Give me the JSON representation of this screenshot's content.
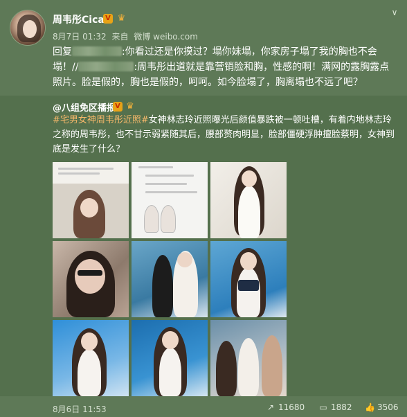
{
  "post": {
    "username": "周韦彤Cica",
    "verified_badge": "V",
    "date": "8月7日 01:32",
    "via_label": "来自",
    "source": "微博 weibo.com",
    "reply_prefix": "回复",
    "text_part1": ":你看过还是你摸过？塌你妹塌，你家房子塌了我的胸也不会塌！//",
    "text_part2": ":周韦彤出道就是靠营销脸和胸，性感的啊！满网的露胸露点照片。脸是假的，胸也是假的，呵呵。如今脸塌了，胸离塌也不远了吧？"
  },
  "repost": {
    "author": "@八组免区播报",
    "verified_badge": "V",
    "hashtag": "#宅男女神周韦彤近照#",
    "text": "女神林志玲近照曝光后颜值暴跌被一顿吐槽，有着内地林志玲之称的周韦彤，也不甘示弱紧随其后，腰部赘肉明显，脸部僵硬浮肿擅脸蔡明，女神到底是发生了什么？",
    "images": [
      {
        "name": "weibo-screenshot-photo"
      },
      {
        "name": "chat-screenshot-photo"
      },
      {
        "name": "white-dress-photo"
      },
      {
        "name": "glasses-selfie-photo"
      },
      {
        "name": "event-stage-photo-1"
      },
      {
        "name": "event-stage-photo-2"
      },
      {
        "name": "event-stage-photo-3"
      },
      {
        "name": "event-stage-photo-4"
      },
      {
        "name": "event-group-photo"
      }
    ],
    "date": "8月6日 11:53",
    "forwards": "11680",
    "comments": "1882",
    "likes": "3506"
  },
  "colors": {
    "background": "#5e7957",
    "repost_background": "#54704d",
    "hashtag": "#f6b86a",
    "badge": "#e8a317"
  },
  "icons": {
    "forward": "forward-icon",
    "comment": "comment-icon",
    "like": "thumbs-up-icon",
    "menu": "chevron-down-icon"
  }
}
